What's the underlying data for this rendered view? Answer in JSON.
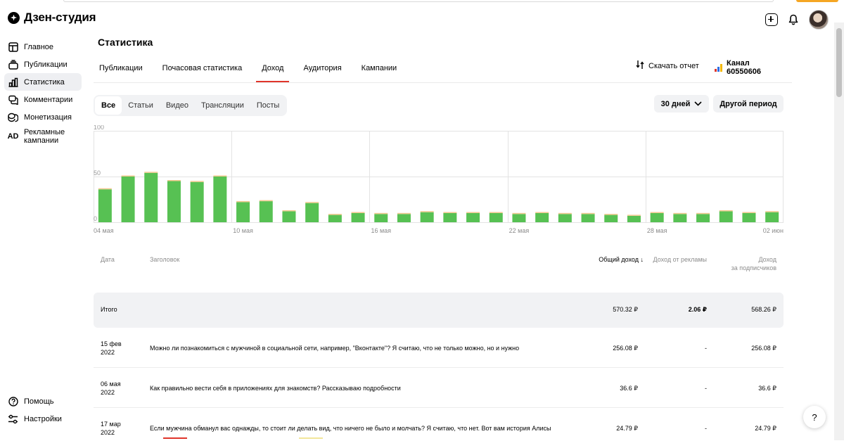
{
  "app": {
    "title": "Дзен-студия"
  },
  "sidebar": {
    "items": [
      {
        "label": "Главное",
        "icon": "home-icon"
      },
      {
        "label": "Публикации",
        "icon": "publications-icon"
      },
      {
        "label": "Статистика",
        "icon": "statistics-icon"
      },
      {
        "label": "Комментарии",
        "icon": "comments-icon"
      },
      {
        "label": "Монетизация",
        "icon": "monetization-icon"
      },
      {
        "label": "Рекламные кампании",
        "icon": "ad-icon",
        "icon_text": "AD"
      }
    ],
    "bottom": [
      {
        "label": "Помощь",
        "icon": "help-icon"
      },
      {
        "label": "Настройки",
        "icon": "settings-icon"
      }
    ],
    "active_index": 2
  },
  "page": {
    "title": "Статистика",
    "tabs": [
      "Публикации",
      "Почасовая статистика",
      "Доход",
      "Аудитория",
      "Кампании"
    ],
    "active_tab": 2,
    "download_label": "Скачать отчет",
    "channel_label": "Канал 60550606"
  },
  "filters": {
    "items": [
      "Все",
      "Статьи",
      "Видео",
      "Трансляции",
      "Посты"
    ],
    "active": 0,
    "period": "30 дней",
    "other_period": "Другой период"
  },
  "colors": {
    "accent": "#e0352b",
    "bar": "#57c153",
    "bar_top": "#f2c98f"
  },
  "chart_data": {
    "type": "bar",
    "ylim": [
      0,
      100
    ],
    "yticks": [
      "100",
      "50",
      "0"
    ],
    "xtick_labels": [
      "04 мая",
      "10 мая",
      "16 мая",
      "22 мая",
      "28 мая",
      "02 июн"
    ],
    "categories": [
      "04 мая",
      "05 мая",
      "06 мая",
      "07 мая",
      "08 мая",
      "09 мая",
      "10 мая",
      "11 мая",
      "12 мая",
      "13 мая",
      "14 мая",
      "15 мая",
      "16 мая",
      "17 мая",
      "18 мая",
      "19 мая",
      "20 мая",
      "21 мая",
      "22 мая",
      "23 мая",
      "24 мая",
      "25 мая",
      "26 мая",
      "27 мая",
      "28 мая",
      "29 мая",
      "30 мая",
      "31 мая",
      "01 июн",
      "02 июн"
    ],
    "values": [
      36,
      50,
      54,
      45,
      44,
      50,
      22,
      23,
      12,
      21,
      8,
      10,
      9,
      9,
      11,
      10,
      10,
      10,
      9,
      10,
      9,
      9,
      8,
      7,
      10,
      9,
      9,
      12,
      10,
      11
    ]
  },
  "table": {
    "headers": {
      "date": "Дата",
      "title": "Заголовок",
      "total": "Общий доход ↓",
      "ads": "Доход от рекламы",
      "subs_line1": "Доход",
      "subs_line2": "за подписчиков"
    },
    "total_row": {
      "label": "Итого",
      "total": "570.32 ₽",
      "ads": "2.06 ₽",
      "subs": "568.26 ₽"
    },
    "rows": [
      {
        "date1": "15 фев",
        "date2": "2022",
        "title": "Можно ли познакомиться с мужчиной в социальной сети, например, \"Вконтакте\"? Я считаю, что не только можно, но и нужно",
        "total": "256.08 ₽",
        "ads": "-",
        "subs": "256.08 ₽"
      },
      {
        "date1": "06 мая",
        "date2": "2022",
        "title": "Как правильно вести себя в приложениях для знакомств? Рассказываю подробности",
        "total": "36.6 ₽",
        "ads": "-",
        "subs": "36.6 ₽"
      },
      {
        "date1": "17 мар",
        "date2": "2022",
        "title": "Если мужчина обманул вас однажды, то стоит ли делать вид, что ничего не было и молчать? Я считаю, что нет. Вот вам история Алисы",
        "total": "24.79 ₽",
        "ads": "-",
        "subs": "24.79 ₽"
      }
    ]
  },
  "help_fab": "?"
}
